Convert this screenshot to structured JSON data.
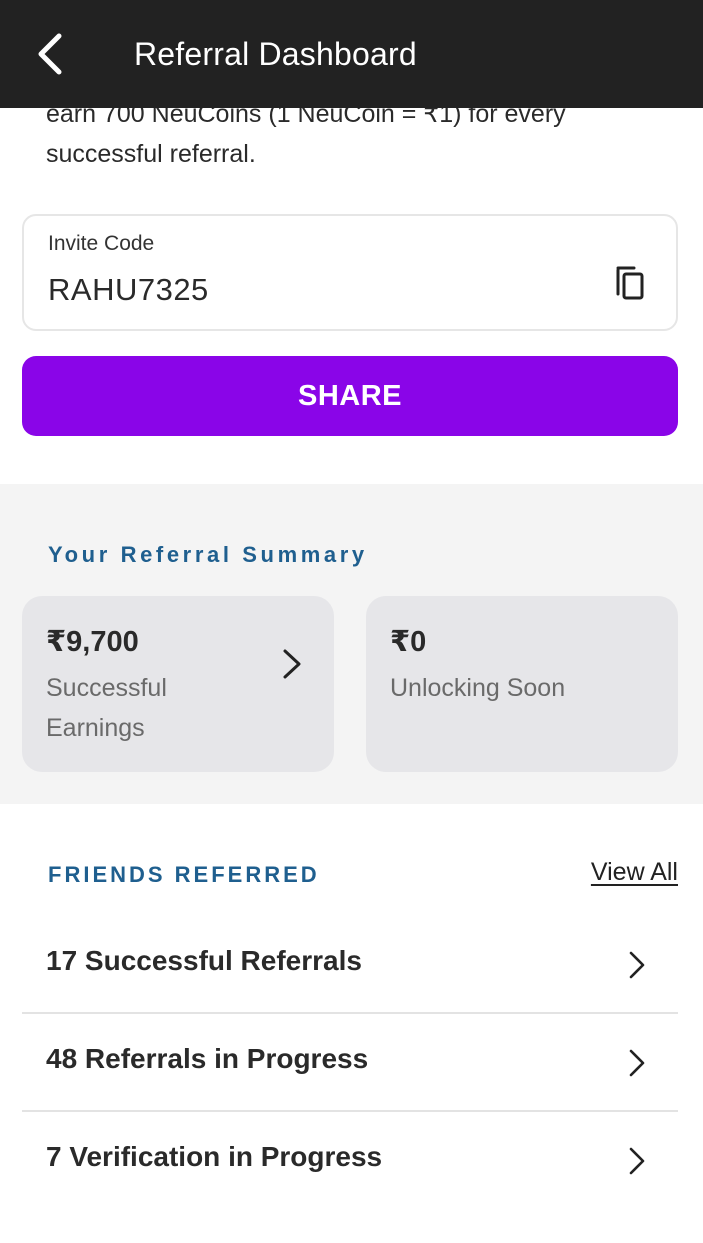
{
  "header": {
    "title": "Referral Dashboard",
    "back_icon": "chevron-left-icon"
  },
  "intro": {
    "text": "earn 700 NeuCoins (1 NeuCoin = ₹1) for every successful referral."
  },
  "invite": {
    "label": "Invite Code",
    "code": "RAHU7325",
    "copy_icon": "copy-icon"
  },
  "share": {
    "label": "SHARE"
  },
  "summary": {
    "heading": "Your Referral Summary",
    "cards": [
      {
        "amount": "₹9,700",
        "label": "Successful Earnings"
      },
      {
        "amount": "₹0",
        "label": "Unlocking Soon"
      }
    ]
  },
  "friends": {
    "heading": "FRIENDS REFERRED",
    "view_all": "View All",
    "items": [
      {
        "label": "17 Successful Referrals"
      },
      {
        "label": "48 Referrals in Progress"
      },
      {
        "label": "7 Verification in Progress"
      }
    ]
  },
  "colors": {
    "header_bg": "#222222",
    "accent": "#8a05e8",
    "heading_blue": "#1f5f8f",
    "summary_bg": "#f4f4f4",
    "card_bg": "#e6e6e9"
  }
}
